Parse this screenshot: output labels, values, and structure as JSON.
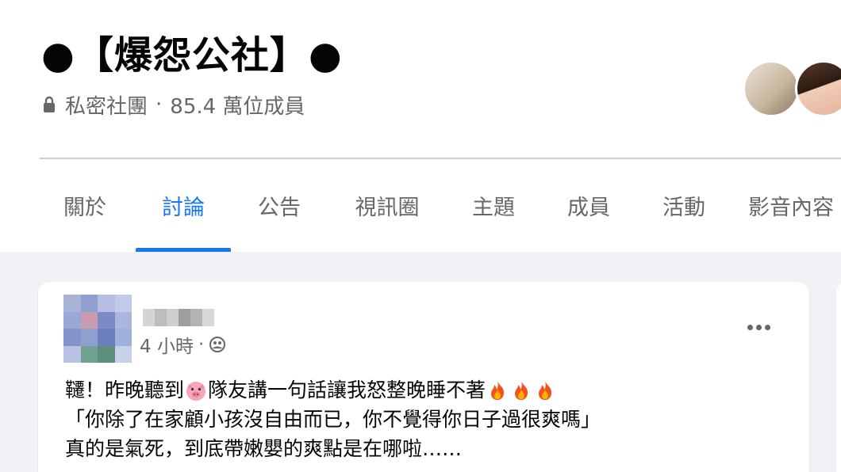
{
  "group": {
    "name": "●【爆怨公社】●",
    "privacy": "私密社團",
    "separator": "·",
    "members": "85.4 萬位成員"
  },
  "tabs": [
    {
      "label": "關於",
      "active": false
    },
    {
      "label": "討論",
      "active": true
    },
    {
      "label": "公告",
      "active": false
    },
    {
      "label": "視訊圈",
      "active": false
    },
    {
      "label": "主題",
      "active": false
    },
    {
      "label": "成員",
      "active": false
    },
    {
      "label": "活動",
      "active": false
    },
    {
      "label": "影音內容",
      "active": false
    }
  ],
  "post": {
    "time": "4 小時",
    "separator": "·",
    "audience_icon": "group-audience-icon",
    "lines": {
      "line1_a": "韆！昨晚聽到",
      "line1_b": "隊友講一句話讓我怒整晚睡不著",
      "line2": "「你除了在家顧小孩沒自由而已，你不覺得你日子過很爽嗎」",
      "line3": "真的是氣死，到底帶嫩嬰的爽點是在哪啦……"
    },
    "emoji": [
      "pig-face-icon",
      "fire-icon",
      "fire-icon",
      "fire-icon"
    ]
  },
  "colors": {
    "accent": "#1877f2",
    "secondary_text": "#65676b",
    "background": "#f0f2f5"
  }
}
